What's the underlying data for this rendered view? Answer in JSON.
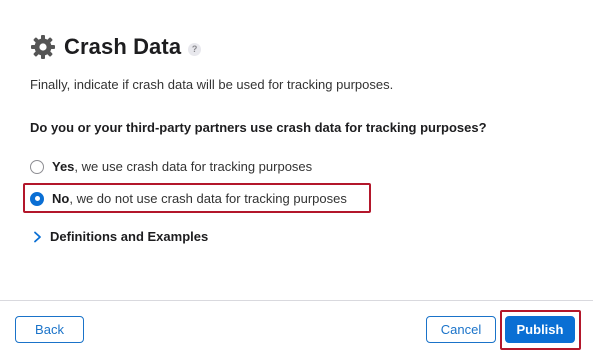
{
  "header": {
    "title": "Crash Data",
    "help": "?"
  },
  "intro": "Finally, indicate if crash data will be used for tracking purposes.",
  "question": "Do you or your third-party partners use crash data for tracking purposes?",
  "options": [
    {
      "bold": "Yes",
      "text": ", we use crash data for tracking purposes",
      "checked": false
    },
    {
      "bold": "No",
      "text": ", we do not use crash data for tracking purposes",
      "checked": true
    }
  ],
  "disclosure": {
    "label": "Definitions and Examples"
  },
  "footer": {
    "back_label": "Back",
    "cancel_label": "Cancel",
    "publish_label": "Publish"
  },
  "colors": {
    "accent": "#0a6fd4",
    "highlight": "#b3172b"
  }
}
